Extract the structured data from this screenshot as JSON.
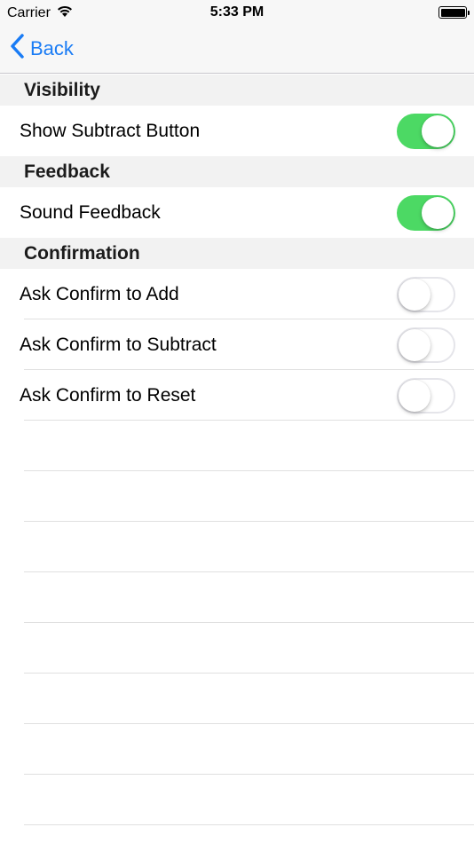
{
  "status_bar": {
    "carrier": "Carrier",
    "time": "5:33 PM",
    "wifi_icon": "wifi-icon",
    "battery_icon": "battery-icon"
  },
  "nav": {
    "back_label": "Back",
    "back_icon": "chevron-left-icon",
    "accent_color": "#1a7cf5"
  },
  "sections": [
    {
      "header": "Visibility",
      "rows": [
        {
          "label": "Show Subtract Button",
          "on": true
        }
      ]
    },
    {
      "header": "Feedback",
      "rows": [
        {
          "label": "Sound Feedback",
          "on": true
        }
      ]
    },
    {
      "header": "Confirmation",
      "rows": [
        {
          "label": "Ask Confirm to Add",
          "on": false
        },
        {
          "label": "Ask Confirm to Subtract",
          "on": false
        },
        {
          "label": "Ask Confirm to Reset",
          "on": false
        }
      ]
    }
  ],
  "colors": {
    "toggle_on": "#4cd964",
    "section_header_bg": "#f2f2f2"
  }
}
